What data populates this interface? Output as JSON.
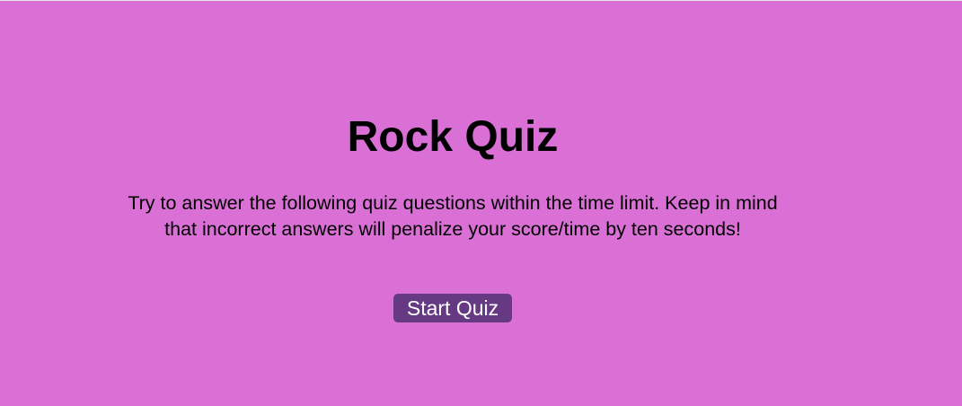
{
  "quiz": {
    "title": "Rock Quiz",
    "instructions": "Try to answer the following quiz questions within the time limit. Keep in mind that incorrect answers will penalize your score/time by ten seconds!",
    "start_label": "Start Quiz"
  },
  "colors": {
    "background": "#da70d6",
    "button": "#663a82",
    "button_text": "#ffffff"
  }
}
